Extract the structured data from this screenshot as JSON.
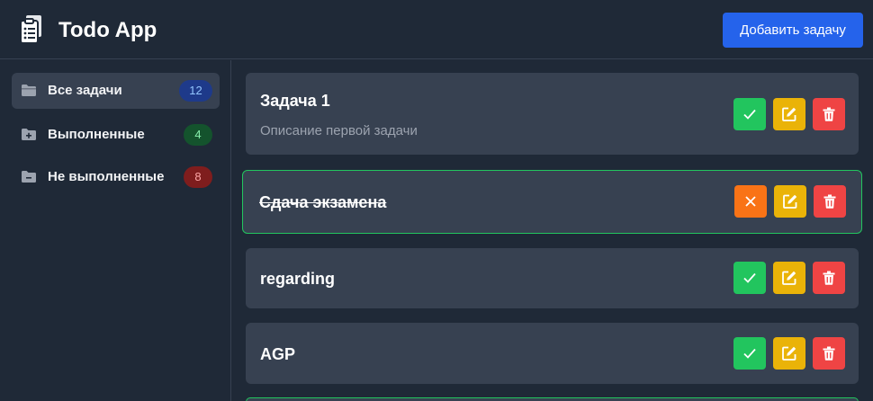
{
  "header": {
    "title": "Todo App",
    "add_button": "Добавить задачу"
  },
  "sidebar": {
    "items": [
      {
        "label": "Все задачи",
        "count": "12",
        "icon": "folder-open-icon"
      },
      {
        "label": "Выполненные",
        "count": "4",
        "icon": "folder-plus-icon"
      },
      {
        "label": "Не выполненные",
        "count": "8",
        "icon": "folder-minus-icon"
      }
    ]
  },
  "tasks": [
    {
      "title": "Задача 1",
      "description": "Описание первой задачи",
      "completed": false
    },
    {
      "title": "Сдача экзамена",
      "description": "",
      "completed": true
    },
    {
      "title": "regarding",
      "description": "",
      "completed": false
    },
    {
      "title": "AGP",
      "description": "",
      "completed": false
    }
  ],
  "colors": {
    "primary": "#2563eb",
    "complete": "#22c55e",
    "edit": "#eab308",
    "delete": "#ef4444",
    "undo": "#f97316"
  }
}
